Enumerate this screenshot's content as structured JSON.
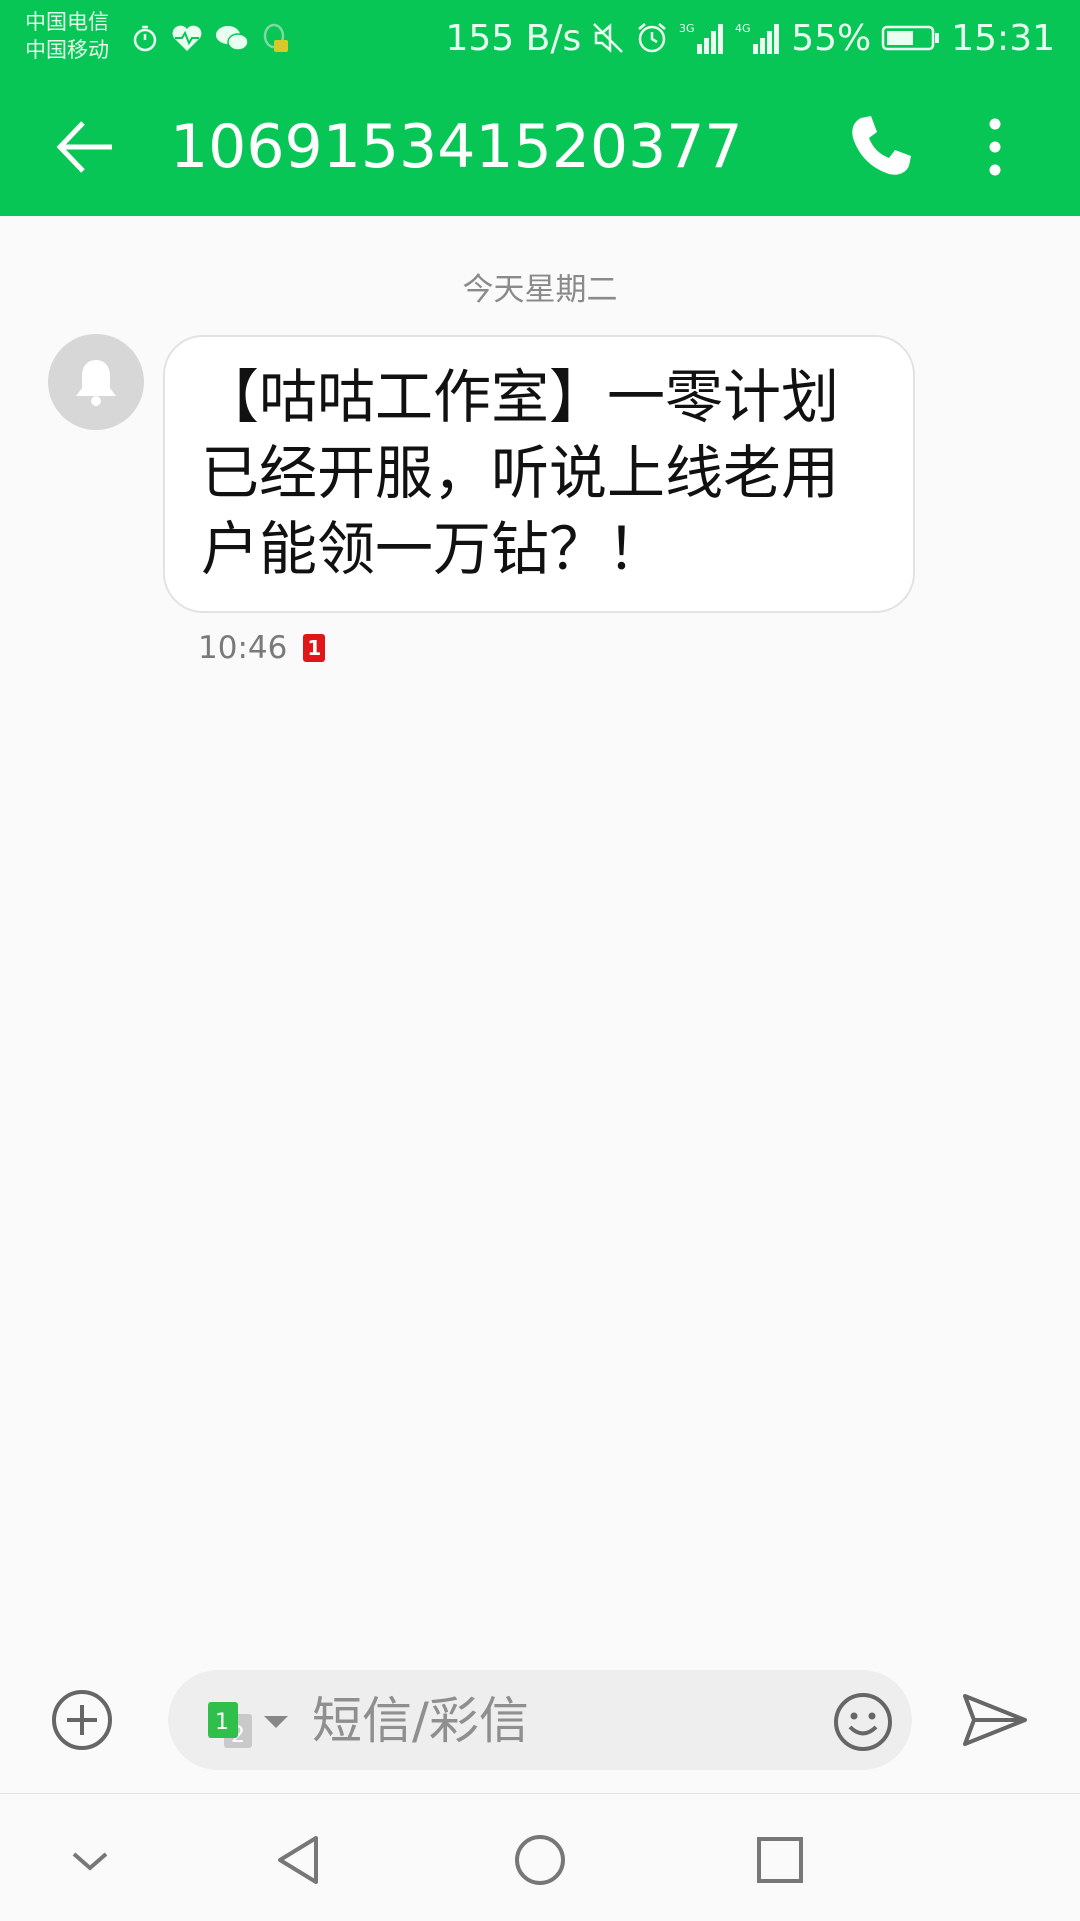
{
  "status_bar": {
    "carrier_1": "中国电信",
    "carrier_2": "中国移动",
    "net_speed": "155 B/s",
    "battery": "55%",
    "time": "15:31",
    "icons": [
      "stopwatch-icon",
      "health-icon",
      "wechat-icon",
      "qq-icon",
      "mute-icon",
      "alarm-icon",
      "signal-3g-icon",
      "signal-4g-icon",
      "battery-icon"
    ]
  },
  "header": {
    "title": "106915341520377",
    "back_icon": "back-arrow-icon",
    "call_icon": "phone-icon",
    "more_icon": "more-vert-icon"
  },
  "conversation": {
    "date_divider": "今天星期二",
    "messages": [
      {
        "sender_avatar": "bell-icon",
        "text": "【咕咕工作室】一零计划已经开服，听说上线老用户能领一万钻？！",
        "time": "10:46",
        "sim": "1"
      }
    ]
  },
  "composer": {
    "placeholder": "短信/彩信",
    "sim_primary": "1",
    "sim_secondary": "2",
    "colors": {
      "sim1": "#2fbf4a",
      "sim2": "#c9c9c9"
    }
  },
  "colors": {
    "accent": "#08c655",
    "sim_badge": "#e0161b"
  }
}
